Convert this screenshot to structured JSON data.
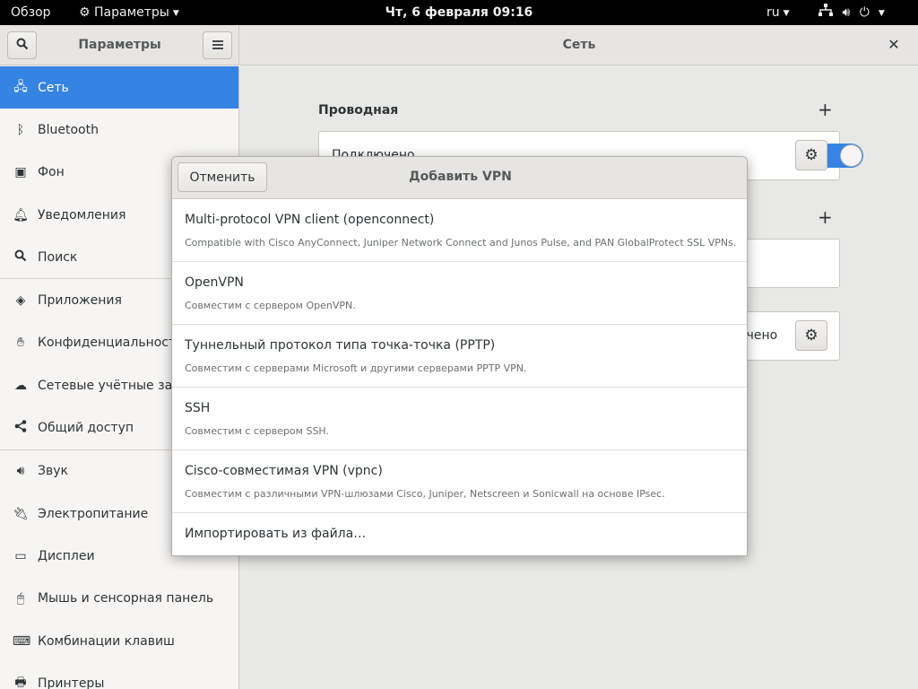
{
  "topbar": {
    "overview": "Обзор",
    "app_menu": "Параметры",
    "clock": "Чт, 6 февраля  09:16",
    "language": "ru"
  },
  "sidebar_header": {
    "title": "Параметры"
  },
  "main_header": {
    "title": "Сеть"
  },
  "sidebar": {
    "items": [
      {
        "label": "Сеть",
        "icon": "network-icon"
      },
      {
        "label": "Bluetooth",
        "icon": "bluetooth-icon"
      },
      {
        "label": "Фон",
        "icon": "background-icon"
      },
      {
        "label": "Уведомления",
        "icon": "bell-icon"
      },
      {
        "label": "Поиск",
        "icon": "search-icon"
      },
      {
        "label": "Приложения",
        "icon": "applications-icon"
      },
      {
        "label": "Конфиденциальность",
        "icon": "privacy-hand-icon"
      },
      {
        "label": "Сетевые учётные записи",
        "icon": "cloud-icon"
      },
      {
        "label": "Общий доступ",
        "icon": "share-icon"
      },
      {
        "label": "Звук",
        "icon": "speaker-icon"
      },
      {
        "label": "Электропитание",
        "icon": "power-plug-icon"
      },
      {
        "label": "Дисплеи",
        "icon": "display-icon"
      },
      {
        "label": "Мышь и сенсорная панель",
        "icon": "mouse-icon"
      },
      {
        "label": "Комбинации клавиш",
        "icon": "keyboard-icon"
      },
      {
        "label": "Принтеры",
        "icon": "printer-icon"
      }
    ]
  },
  "network": {
    "wired_title": "Проводная",
    "wired_status": "Подключено",
    "proxy_status_fragment": "очено"
  },
  "dialog": {
    "title": "Добавить VPN",
    "cancel_label": "Отменить",
    "options": [
      {
        "name": "Multi-protocol VPN client (openconnect)",
        "desc": "Compatible with Cisco AnyConnect, Juniper Network Connect and Junos Pulse, and PAN GlobalProtect SSL VPNs."
      },
      {
        "name": "OpenVPN",
        "desc": "Совместим с сервером OpenVPN."
      },
      {
        "name": "Туннельный протокол типа точка-точка (PPTP)",
        "desc": "Совместим с серверами Microsoft и другими серверами PPTP VPN."
      },
      {
        "name": "SSH",
        "desc": "Совместим с сервером SSH."
      },
      {
        "name": "Cisco-совместимая VPN (vpnc)",
        "desc": "Совместим с различными VPN-шлюзами Cisco, Juniper, Netscreen и Sonicwall на основе IPsec."
      }
    ],
    "import_label": "Импортировать из файла…"
  },
  "colors": {
    "accent": "#3584e4",
    "topbar": "#000000"
  }
}
